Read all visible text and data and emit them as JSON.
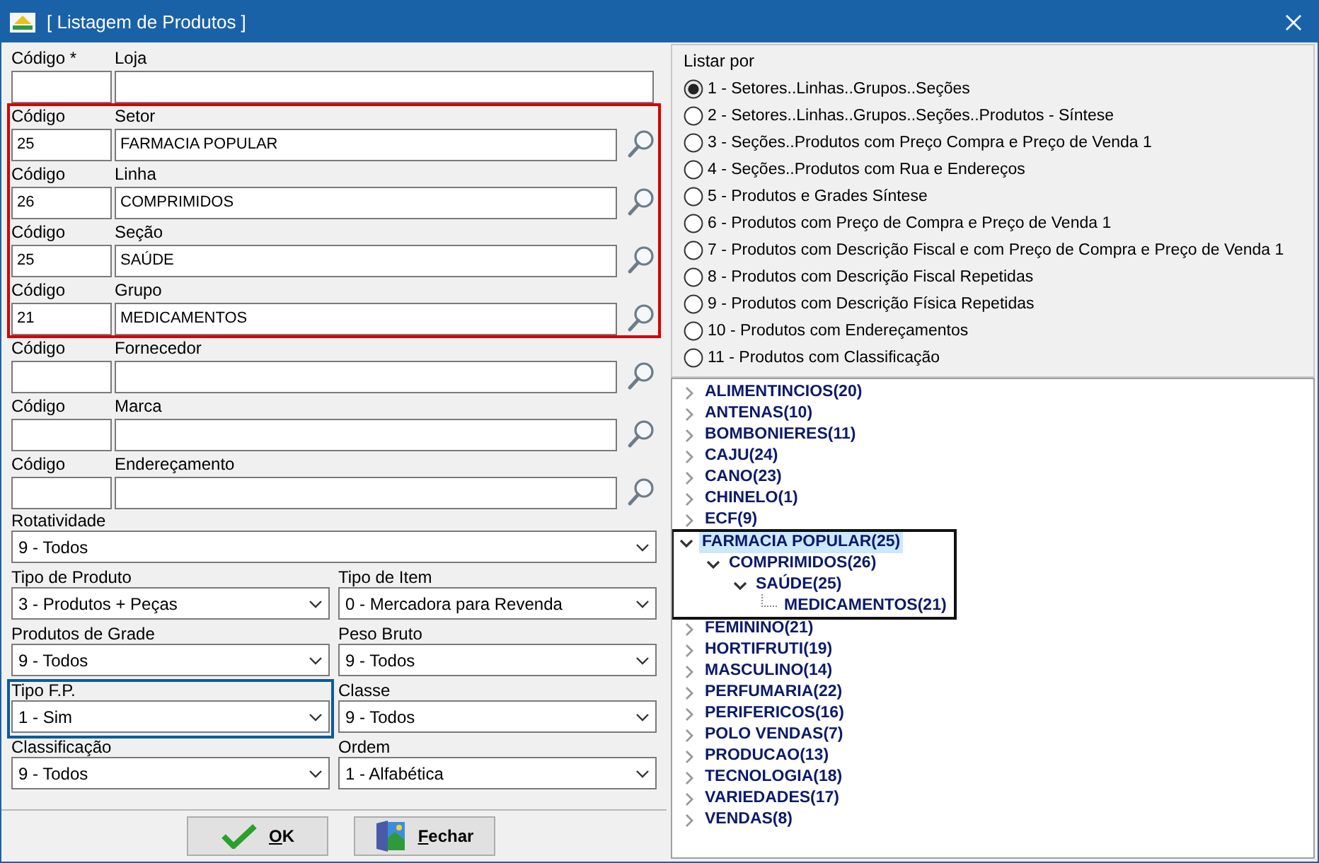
{
  "window": {
    "title": "[ Listagem de Produtos ]"
  },
  "lookup_sections": [
    {
      "highlighted": false,
      "rows": [
        {
          "code_label": "Código *",
          "name_label": "Loja",
          "code": "",
          "name": "",
          "searchable": false
        }
      ]
    },
    {
      "highlighted": true,
      "rows": [
        {
          "code_label": "Código",
          "name_label": "Setor",
          "code": "25",
          "name": "FARMACIA POPULAR",
          "searchable": true
        },
        {
          "code_label": "Código",
          "name_label": "Linha",
          "code": "26",
          "name": "COMPRIMIDOS",
          "searchable": true
        },
        {
          "code_label": "Código",
          "name_label": "Seção",
          "code": "25",
          "name": "SAÚDE",
          "searchable": true
        },
        {
          "code_label": "Código",
          "name_label": "Grupo",
          "code": "21",
          "name": "MEDICAMENTOS",
          "searchable": true
        }
      ]
    },
    {
      "highlighted": false,
      "rows": [
        {
          "code_label": "Código",
          "name_label": "Fornecedor",
          "code": "",
          "name": "",
          "searchable": true
        },
        {
          "code_label": "Código",
          "name_label": "Marca",
          "code": "",
          "name": "",
          "searchable": true
        },
        {
          "code_label": "Código",
          "name_label": "Endereçamento",
          "code": "",
          "name": "",
          "searchable": true
        }
      ]
    }
  ],
  "selects": [
    {
      "label": "Rotatividade",
      "value": "9 - Todos",
      "wide": true,
      "highlighted": false
    },
    {
      "label": "Tipo de Produto",
      "value": "3 - Produtos + Peças",
      "wide": false,
      "highlighted": false
    },
    {
      "label": "Tipo de Item",
      "value": "0 - Mercadora para Revenda",
      "wide": false,
      "highlighted": false
    },
    {
      "label": "Produtos de Grade",
      "value": "9 - Todos",
      "wide": false,
      "highlighted": false
    },
    {
      "label": "Peso Bruto",
      "value": "9 - Todos",
      "wide": false,
      "highlighted": false
    },
    {
      "label": "Tipo F.P.",
      "value": "1 - Sim",
      "wide": false,
      "highlighted": true
    },
    {
      "label": "Classe",
      "value": "9 - Todos",
      "wide": false,
      "highlighted": false
    },
    {
      "label": "Classificação",
      "value": "9 - Todos",
      "wide": false,
      "highlighted": false
    },
    {
      "label": "Ordem",
      "value": "1 - Alfabética",
      "wide": false,
      "highlighted": false
    }
  ],
  "buttons": [
    {
      "label": "OK",
      "kind": "ok"
    },
    {
      "label": "Fechar",
      "kind": "close"
    }
  ],
  "list_by": {
    "title": "Listar por",
    "options": [
      {
        "label": "1 - Setores..Linhas..Grupos..Seções",
        "selected": true
      },
      {
        "label": "2 - Setores..Linhas..Grupos..Seções..Produtos - Síntese",
        "selected": false
      },
      {
        "label": "3 - Seções..Produtos com Preço Compra e Preço de Venda 1",
        "selected": false
      },
      {
        "label": "4 - Seções..Produtos com Rua e Endereços",
        "selected": false
      },
      {
        "label": "5 - Produtos e Grades Síntese",
        "selected": false
      },
      {
        "label": "6 - Produtos com Preço de Compra e Preço de Venda 1",
        "selected": false
      },
      {
        "label": "7 - Produtos com Descrição Fiscal e com Preço de Compra e Preço de Venda 1",
        "selected": false
      },
      {
        "label": "8 - Produtos com Descrição Fiscal Repetidas",
        "selected": false
      },
      {
        "label": "9 - Produtos com Descrição Física Repetidas",
        "selected": false
      },
      {
        "label": "10 - Produtos com Endereçamentos",
        "selected": false
      },
      {
        "label": "11 - Produtos com Classificação",
        "selected": false
      }
    ]
  },
  "tree": [
    {
      "label": "ALIMENTINCIOS(20)",
      "expanded": false,
      "selected": false,
      "highlighted": false
    },
    {
      "label": "ANTENAS(10)",
      "expanded": false,
      "selected": false,
      "highlighted": false
    },
    {
      "label": "BOMBONIERES(11)",
      "expanded": false,
      "selected": false,
      "highlighted": false
    },
    {
      "label": "CAJU(24)",
      "expanded": false,
      "selected": false,
      "highlighted": false
    },
    {
      "label": "CANO(23)",
      "expanded": false,
      "selected": false,
      "highlighted": false
    },
    {
      "label": "CHINELO(1)",
      "expanded": false,
      "selected": false,
      "highlighted": false
    },
    {
      "label": "ECF(9)",
      "expanded": false,
      "selected": false,
      "highlighted": false
    },
    {
      "label": "FARMACIA POPULAR(25)",
      "expanded": true,
      "selected": true,
      "highlighted": true,
      "children": [
        {
          "label": "COMPRIMIDOS(26)",
          "expanded": true,
          "selected": false,
          "highlighted": false,
          "children": [
            {
              "label": "SAÚDE(25)",
              "expanded": true,
              "selected": false,
              "highlighted": false,
              "children": [
                {
                  "label": "MEDICAMENTOS(21)",
                  "selected": false,
                  "highlighted": false
                }
              ]
            }
          ]
        }
      ]
    },
    {
      "label": "FEMININO(21)",
      "expanded": false,
      "selected": false,
      "highlighted": false
    },
    {
      "label": "HORTIFRUTI(19)",
      "expanded": false,
      "selected": false,
      "highlighted": false
    },
    {
      "label": "MASCULINO(14)",
      "expanded": false,
      "selected": false,
      "highlighted": false
    },
    {
      "label": "PERFUMARIA(22)",
      "expanded": false,
      "selected": false,
      "highlighted": false
    },
    {
      "label": "PERIFERICOS(16)",
      "expanded": false,
      "selected": false,
      "highlighted": false
    },
    {
      "label": "POLO VENDAS(7)",
      "expanded": false,
      "selected": false,
      "highlighted": false
    },
    {
      "label": "PRODUCAO(13)",
      "expanded": false,
      "selected": false,
      "highlighted": false
    },
    {
      "label": "TECNOLOGIA(18)",
      "expanded": false,
      "selected": false,
      "highlighted": false
    },
    {
      "label": "VARIEDADES(17)",
      "expanded": false,
      "selected": false,
      "highlighted": false
    },
    {
      "label": "VENDAS(8)",
      "expanded": false,
      "selected": false,
      "highlighted": false
    }
  ]
}
